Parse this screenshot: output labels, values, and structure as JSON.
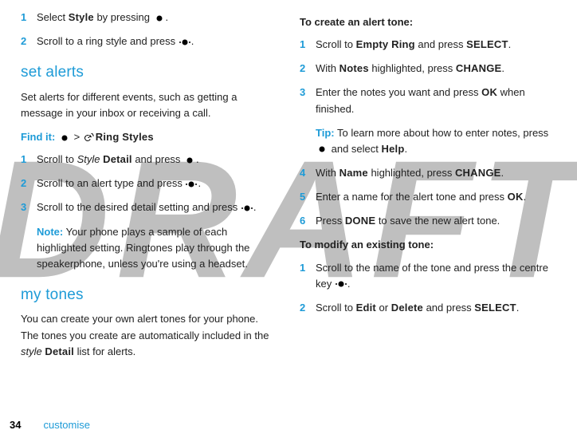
{
  "watermark": "DRAFT",
  "left": {
    "steps_a": [
      {
        "num": "1",
        "pre": "Select ",
        "cond": "Style",
        "post": " by pressing ",
        "keytype": "plain",
        "tail": "."
      },
      {
        "num": "2",
        "pre": "Scroll to a ring style and press ",
        "keytype": "dots",
        "tail": "."
      }
    ],
    "section1": "set alerts",
    "para1": "Set alerts for different events, such as getting a message in your inbox or receiving a call.",
    "findit_label": "Find it:",
    "findit_sep": " > ",
    "findit_cond": "Ring Styles",
    "steps_b": [
      {
        "num": "1",
        "pre": "Scroll to ",
        "ital": "Style",
        "space": " ",
        "cond": "Detail",
        "post": " and press ",
        "keytype": "plain",
        "tail": "."
      },
      {
        "num": "2",
        "pre": "Scroll to an alert type and press ",
        "keytype": "dots",
        "tail": "."
      },
      {
        "num": "3",
        "pre": "Scroll to the desired detail setting and press ",
        "keytype": "dots",
        "tail": "."
      }
    ],
    "note_label": "Note:",
    "note_body": " Your phone plays a sample of each highlighted setting. Ringtones play through the speakerphone, unless you're using a headset.",
    "section2": "my tones",
    "para2_a": "You can create your own alert tones for your phone. The tones you create are automatically included in the ",
    "para2_ital": "style",
    "para2_space": " ",
    "para2_cond": "Detail",
    "para2_b": " list for alerts."
  },
  "right": {
    "heading_a": "To create an alert tone",
    "colon": ":",
    "steps_c": [
      {
        "num": "1",
        "pre": "Scroll to ",
        "cond": "Empty Ring",
        "mid": " and press ",
        "cond2": "SELECT",
        "tail": "."
      },
      {
        "num": "2",
        "pre": "With ",
        "cond": "Notes",
        "mid": " highlighted, press ",
        "cond2": "CHANGE",
        "tail": "."
      },
      {
        "num": "3",
        "pre": "Enter the notes you want and press ",
        "cond": "OK",
        "mid": " when finished."
      }
    ],
    "tip_label": "Tip:",
    "tip_a": " To learn more about how to enter notes, press ",
    "tip_b": " and select ",
    "tip_cond": "Help",
    "tip_tail": ".",
    "steps_d": [
      {
        "num": "4",
        "pre": "With ",
        "cond": "Name",
        "mid": " highlighted, press ",
        "cond2": "CHANGE",
        "tail": "."
      },
      {
        "num": "5",
        "pre": "Enter a name for the alert tone and press ",
        "cond": "OK",
        "tail": "."
      },
      {
        "num": "6",
        "pre": "Press ",
        "cond": "DONE",
        "mid": " to save the new alert tone."
      }
    ],
    "heading_b": "To modify an existing tone",
    "steps_e1_num": "1",
    "steps_e1_a": "Scroll to the name of the tone and press the centre key ",
    "steps_e1_tail": ".",
    "steps_e2_num": "2",
    "steps_e2_a": "Scroll to ",
    "steps_e2_c1": "Edit",
    "steps_e2_or": " or ",
    "steps_e2_c2": "Delete",
    "steps_e2_mid": " and press ",
    "steps_e2_c3": "SELECT",
    "steps_e2_tail": "."
  },
  "footer": {
    "page": "34",
    "section": "customise"
  }
}
